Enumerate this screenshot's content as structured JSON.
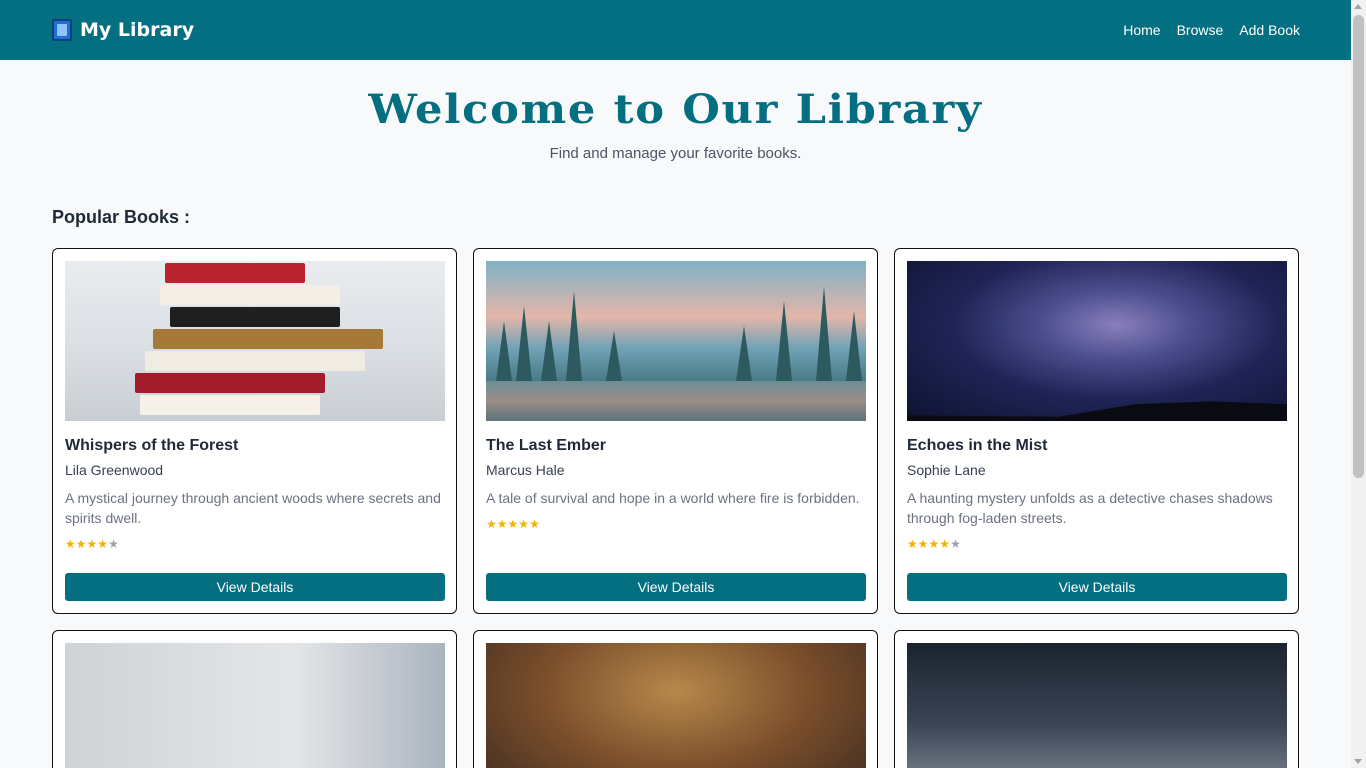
{
  "brand": {
    "icon": "book-icon",
    "name": "My Library"
  },
  "nav": {
    "links": [
      "Home",
      "Browse",
      "Add Book"
    ]
  },
  "hero": {
    "title": "Welcome to Our Library",
    "subtitle": "Find and manage your favorite books."
  },
  "section": {
    "title": "Popular Books :"
  },
  "colors": {
    "primary": "#046f81",
    "star": "#f0b400"
  },
  "books": [
    {
      "title": "Whispers of the Forest",
      "author": "Lila Greenwood",
      "description": "A mystical journey through ancient woods where secrets and spirits dwell.",
      "rating": 4,
      "rating_max": 5,
      "button": "View Details",
      "image": "stack-of-books-photo"
    },
    {
      "title": "The Last Ember",
      "author": "Marcus Hale",
      "description": "A tale of survival and hope in a world where fire is forbidden.",
      "rating": 5,
      "rating_max": 5,
      "button": "View Details",
      "image": "forest-valley-photo"
    },
    {
      "title": "Echoes in the Mist",
      "author": "Sophie Lane",
      "description": "A haunting mystery unfolds as a detective chases shadows through fog-laden streets.",
      "rating": 4,
      "rating_max": 5,
      "button": "View Details",
      "image": "milky-way-photo"
    }
  ],
  "partial_cards": [
    {
      "image": "potted-plants-photo"
    },
    {
      "image": "open-bible-photo"
    },
    {
      "image": "starry-mountains-photo"
    }
  ]
}
